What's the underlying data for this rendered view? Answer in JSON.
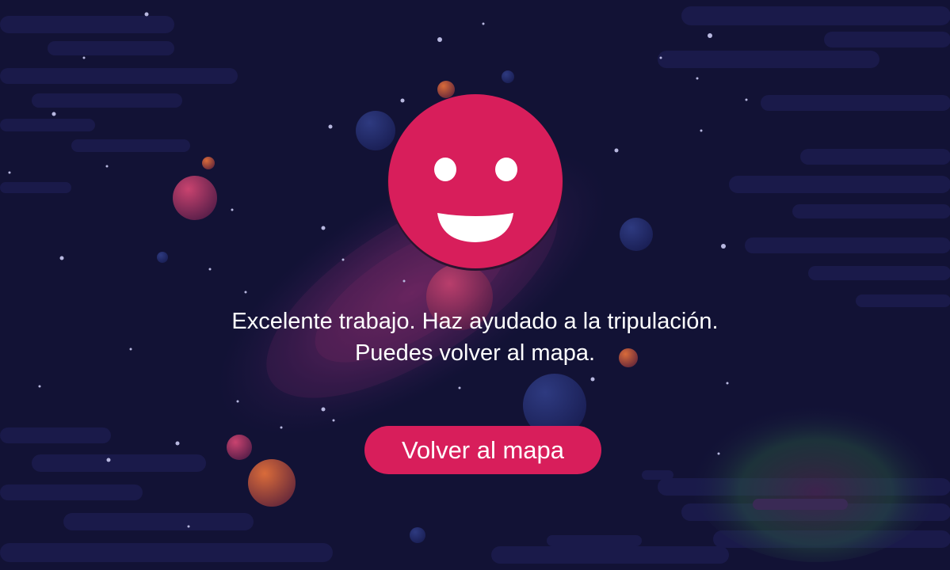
{
  "screen": {
    "message_line1": "Excelente trabajo. Haz ayudado a la tripulación.",
    "message_line2": "Puedes volver al mapa.",
    "button_label": "Volver al mapa",
    "smiley_icon": "happy-face-icon"
  },
  "colors": {
    "background": "#121235",
    "cloud": "#1a1a4a",
    "accent": "#d81e5b",
    "text": "#ffffff",
    "star": "#b8b8e0"
  }
}
